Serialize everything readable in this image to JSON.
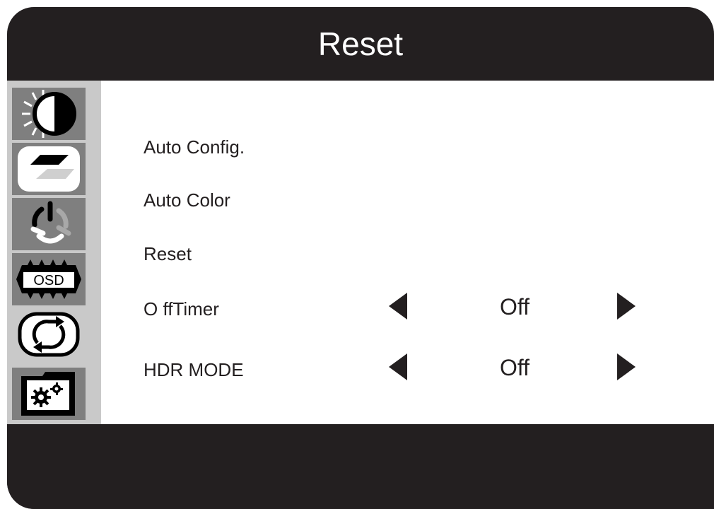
{
  "header": {
    "title": "Reset"
  },
  "sidebar": {
    "icons": [
      {
        "name": "brightness-contrast-icon",
        "selected": false
      },
      {
        "name": "image-setup-icon",
        "selected": false
      },
      {
        "name": "color-temperature-icon",
        "selected": false
      },
      {
        "name": "osd-settings-icon",
        "selected": false,
        "label": "OSD"
      },
      {
        "name": "reset-icon",
        "selected": true
      },
      {
        "name": "misc-settings-icon",
        "selected": false
      }
    ]
  },
  "menu": {
    "items": [
      {
        "label": "Auto Config."
      },
      {
        "label": "Auto Color"
      },
      {
        "label": "Reset"
      },
      {
        "label": "O ffTimer",
        "value": "Off"
      },
      {
        "label": "HDR MODE",
        "value": "Off"
      }
    ]
  },
  "colors": {
    "frame": "#231f20",
    "sidebar": "#c9c9c9",
    "icon_bg": "#7f7f7f",
    "panel": "#ffffff"
  }
}
